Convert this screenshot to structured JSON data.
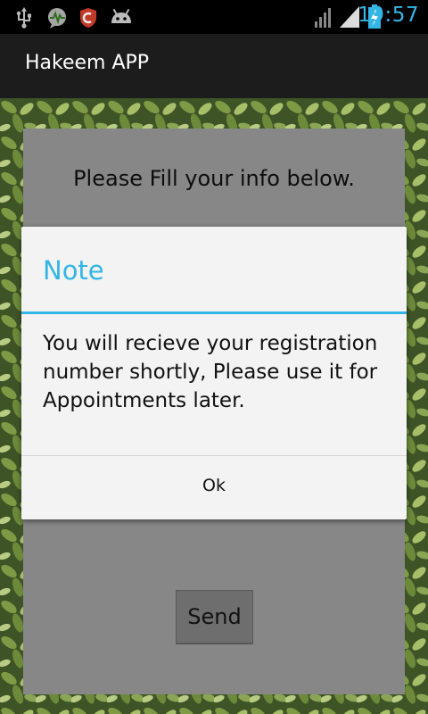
{
  "status_bar": {
    "time": "19:57",
    "icons": [
      "usb-icon",
      "activity-monitor-icon",
      "security-shield-icon",
      "android-debug-icon",
      "wifi-icon",
      "signal-icon",
      "battery-charging-icon"
    ]
  },
  "action_bar": {
    "title": "Hakeem APP"
  },
  "form": {
    "instructions": "Please Fill your info below.",
    "send_label": "Send"
  },
  "dialog": {
    "title": "Note",
    "message": "You will recieve your registration number shortly, Please use it for Appointments later.",
    "ok_label": "Ok"
  },
  "colors": {
    "accent": "#33b5e5",
    "dialog_bg": "#f3f3f3",
    "action_bar_bg": "#1c1c1c"
  }
}
